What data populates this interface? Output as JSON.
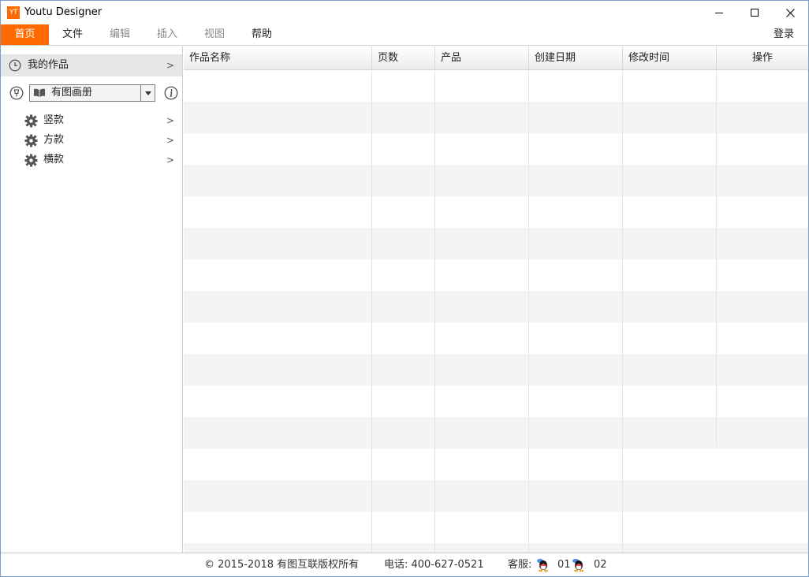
{
  "app": {
    "logo_text": "YT",
    "title": "Youtu Designer",
    "accent_color": "#ff6a00"
  },
  "menu": {
    "items": [
      {
        "label": "首页",
        "state": "active"
      },
      {
        "label": "文件",
        "state": "normal"
      },
      {
        "label": "编辑",
        "state": "disabled"
      },
      {
        "label": "插入",
        "state": "disabled"
      },
      {
        "label": "视图",
        "state": "disabled"
      },
      {
        "label": "帮助",
        "state": "normal"
      }
    ],
    "login_label": "登录"
  },
  "sidebar": {
    "my_works_label": "我的作品",
    "category_select": "有图画册",
    "items": [
      {
        "label": "竖款"
      },
      {
        "label": "方款"
      },
      {
        "label": "横款"
      }
    ],
    "chevron": ">"
  },
  "table": {
    "columns": [
      "作品名称",
      "页数",
      "产品",
      "创建日期",
      "修改时间",
      "操作"
    ],
    "rows": []
  },
  "status": {
    "copyright": "© 2015-2018 有图互联版权所有",
    "phone": "电话: 400-627-0521",
    "service_label": "客服:",
    "qq1": "01",
    "qq2": "02"
  }
}
